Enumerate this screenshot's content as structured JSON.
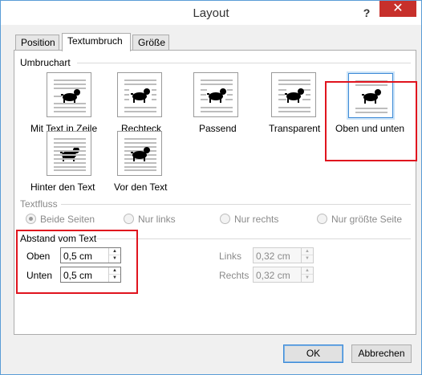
{
  "window": {
    "title": "Layout",
    "help": "?",
    "close": "✕"
  },
  "tabs": [
    {
      "label": "Position"
    },
    {
      "label": "Textumbruch"
    },
    {
      "label": "Größe"
    }
  ],
  "wrap": {
    "heading": "Umbruchart",
    "options": [
      {
        "label": "Mit Text in Zeile",
        "icon": "inline-dog-icon"
      },
      {
        "label": "Rechteck",
        "icon": "square-wrap-dog-icon"
      },
      {
        "label": "Passend",
        "icon": "tight-wrap-dog-icon"
      },
      {
        "label": "Transparent",
        "icon": "through-wrap-dog-icon"
      },
      {
        "label": "Oben und unten",
        "icon": "top-bottom-dog-icon",
        "selected": true
      },
      {
        "label": "Hinter den Text",
        "icon": "behind-text-dog-icon"
      },
      {
        "label": "Vor den Text",
        "icon": "in-front-dog-icon"
      }
    ]
  },
  "textflow": {
    "heading": "Textfluss",
    "options": [
      {
        "label": "Beide Seiten",
        "checked": true
      },
      {
        "label": "Nur links"
      },
      {
        "label": "Nur rechts"
      },
      {
        "label": "Nur größte Seite"
      }
    ]
  },
  "distance": {
    "heading": "Abstand vom Text",
    "oben": {
      "label": "Oben",
      "value": "0,5 cm"
    },
    "unten": {
      "label": "Unten",
      "value": "0,5 cm"
    },
    "links": {
      "label": "Links",
      "value": "0,32 cm"
    },
    "rechts": {
      "label": "Rechts",
      "value": "0,32 cm"
    }
  },
  "buttons": {
    "ok": "OK",
    "cancel": "Abbrechen"
  },
  "colors": {
    "highlight": "#e0141e",
    "close": "#c7302b",
    "accent": "#3c8ad7"
  }
}
